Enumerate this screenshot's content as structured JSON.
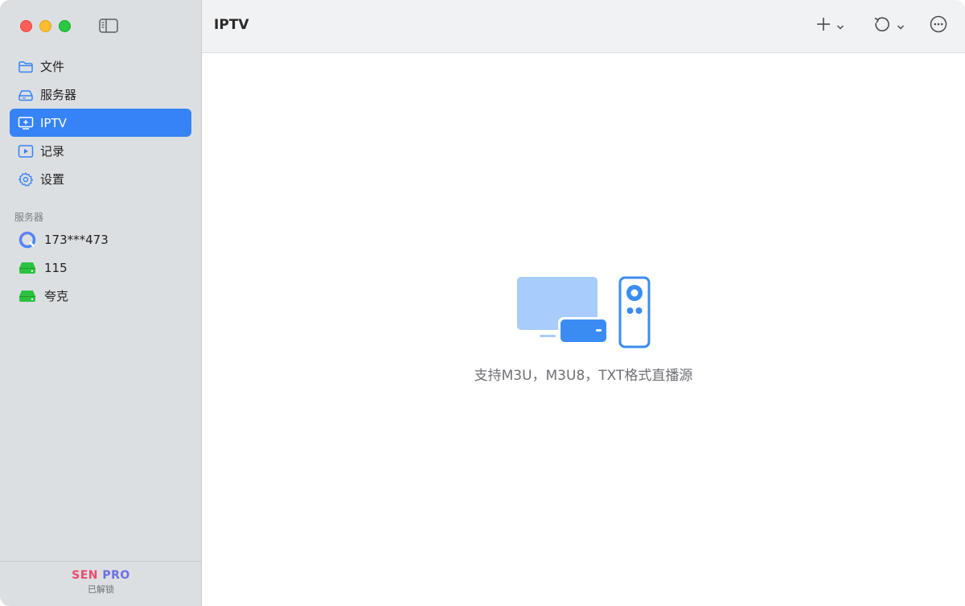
{
  "sidebar": {
    "nav": [
      {
        "label": "文件",
        "icon": "folder-icon"
      },
      {
        "label": "服务器",
        "icon": "server-drive-icon"
      },
      {
        "label": "IPTV",
        "icon": "tv-icon"
      },
      {
        "label": "记录",
        "icon": "play-record-icon"
      },
      {
        "label": "设置",
        "icon": "gear-icon"
      }
    ],
    "active_index": 2,
    "section_label": "服务器",
    "servers": [
      {
        "label": "173***473",
        "icon": "cloud-ring-icon"
      },
      {
        "label": "115",
        "icon": "green-drive-icon"
      },
      {
        "label": "夸克",
        "icon": "green-drive-icon"
      }
    ],
    "footer": {
      "sen": "SEN",
      "pro": "PRO",
      "status": "已解锁"
    }
  },
  "toolbar": {
    "title": "IPTV",
    "buttons": [
      "plus-icon",
      "refresh-icon",
      "more-icon"
    ]
  },
  "main": {
    "empty_text": "支持M3U，M3U8，TXT格式直播源",
    "illustration": "tv-box-remote-icon"
  },
  "colors": {
    "accent": "#3583f6",
    "sidebar_bg": "#dcdfe2",
    "pro_red": "#e94b6c",
    "pro_purple": "#6a6ee8",
    "drive_green": "#2bc23f"
  }
}
